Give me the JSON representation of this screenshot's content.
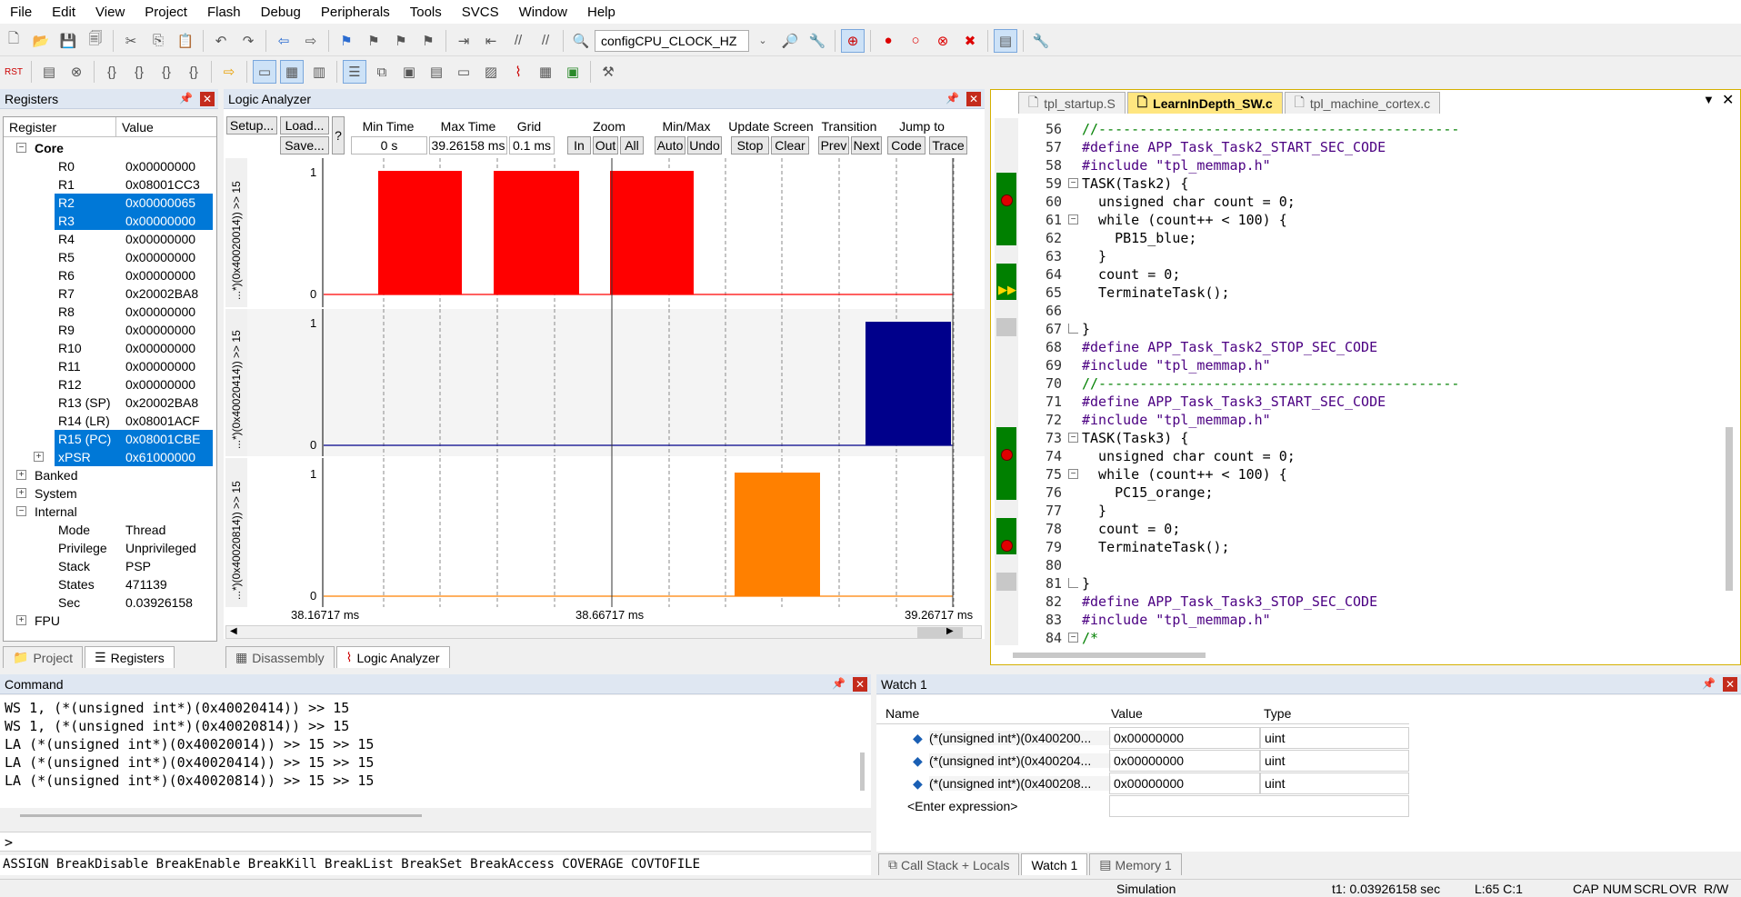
{
  "menu": [
    "File",
    "Edit",
    "View",
    "Project",
    "Flash",
    "Debug",
    "Peripherals",
    "Tools",
    "SVCS",
    "Window",
    "Help"
  ],
  "toolbar": {
    "target_combo": "configCPU_CLOCK_HZ"
  },
  "registers_panel": {
    "title": "Registers",
    "col_register": "Register",
    "col_value": "Value",
    "groups": {
      "core": "Core",
      "banked": "Banked",
      "system": "System",
      "internal": "Internal",
      "fpu": "FPU"
    },
    "core": [
      {
        "name": "R0",
        "value": "0x00000000"
      },
      {
        "name": "R1",
        "value": "0x08001CC3"
      },
      {
        "name": "R2",
        "value": "0x00000065"
      },
      {
        "name": "R3",
        "value": "0x00000000"
      },
      {
        "name": "R4",
        "value": "0x00000000"
      },
      {
        "name": "R5",
        "value": "0x00000000"
      },
      {
        "name": "R6",
        "value": "0x00000000"
      },
      {
        "name": "R7",
        "value": "0x20002BA8"
      },
      {
        "name": "R8",
        "value": "0x00000000"
      },
      {
        "name": "R9",
        "value": "0x00000000"
      },
      {
        "name": "R10",
        "value": "0x00000000"
      },
      {
        "name": "R11",
        "value": "0x00000000"
      },
      {
        "name": "R12",
        "value": "0x00000000"
      },
      {
        "name": "R13 (SP)",
        "value": "0x20002BA8"
      },
      {
        "name": "R14 (LR)",
        "value": "0x08001ACF"
      },
      {
        "name": "R15 (PC)",
        "value": "0x08001CBE"
      },
      {
        "name": "xPSR",
        "value": "0x61000000"
      }
    ],
    "internal": [
      {
        "name": "Mode",
        "value": "Thread"
      },
      {
        "name": "Privilege",
        "value": "Unprivileged"
      },
      {
        "name": "Stack",
        "value": "PSP"
      },
      {
        "name": "States",
        "value": "471139"
      },
      {
        "name": "Sec",
        "value": "0.03926158"
      }
    ],
    "tabs": [
      "Project",
      "Registers"
    ]
  },
  "logic_analyzer": {
    "title": "Logic Analyzer",
    "setup": "Setup...",
    "load": "Load...",
    "save": "Save...",
    "help": "?",
    "min_time_label": "Min Time",
    "min_time": "0 s",
    "max_time_label": "Max Time",
    "max_time": "39.26158 ms",
    "grid_label": "Grid",
    "grid": "0.1 ms",
    "zoom_label": "Zoom",
    "zoom_in": "In",
    "zoom_out": "Out",
    "zoom_all": "All",
    "minmax_label": "Min/Max",
    "minmax_auto": "Auto",
    "minmax_undo": "Undo",
    "update_label": "Update Screen",
    "update_stop": "Stop",
    "update_clear": "Clear",
    "transition_label": "Transition",
    "transition_prev": "Prev",
    "transition_next": "Next",
    "jump_label": "Jump to",
    "jump_code": "Code",
    "jump_trace": "Trace",
    "signals": [
      {
        "label": "...*)(0x40020014)) >> 15",
        "hi": "1",
        "lo": "0",
        "color": "#ff0000"
      },
      {
        "label": "...*)(0x40020414)) >> 15",
        "hi": "1",
        "lo": "0",
        "color": "#00008b"
      },
      {
        "label": "...*)(0x40020814)) >> 15",
        "hi": "1",
        "lo": "0",
        "color": "#ff8000"
      }
    ],
    "time_labels": [
      "38.16717 ms",
      "38.66717 ms",
      "39.26717 ms"
    ],
    "tabs": [
      "Disassembly",
      "Logic Analyzer"
    ]
  },
  "editor": {
    "tabs": [
      "tpl_startup.S",
      "LearnInDepth_SW.c",
      "tpl_machine_cortex.c"
    ],
    "lines": [
      {
        "n": "56",
        "text": "//--------------------------------------------",
        "kind": "comment"
      },
      {
        "n": "57",
        "text": "#define APP_Task_Task2_START_SEC_CODE",
        "kind": "define"
      },
      {
        "n": "58",
        "text": "#include \"tpl_memmap.h\"",
        "kind": "include"
      },
      {
        "n": "59",
        "text": "TASK(Task2) {",
        "kind": "plain"
      },
      {
        "n": "60",
        "text": "  unsigned char count = 0;",
        "kind": "decl"
      },
      {
        "n": "61",
        "text": "  while (count++ < 100) {",
        "kind": "while"
      },
      {
        "n": "62",
        "text": "    PB15_blue;",
        "kind": "plain"
      },
      {
        "n": "63",
        "text": "  }",
        "kind": "plain"
      },
      {
        "n": "64",
        "text": "  count = 0;",
        "kind": "assign"
      },
      {
        "n": "65",
        "text": "  TerminateTask();",
        "kind": "plain"
      },
      {
        "n": "66",
        "text": "",
        "kind": "plain"
      },
      {
        "n": "67",
        "text": "}",
        "kind": "plain"
      },
      {
        "n": "68",
        "text": "#define APP_Task_Task2_STOP_SEC_CODE",
        "kind": "define"
      },
      {
        "n": "69",
        "text": "#include \"tpl_memmap.h\"",
        "kind": "include"
      },
      {
        "n": "70",
        "text": "//--------------------------------------------",
        "kind": "comment"
      },
      {
        "n": "71",
        "text": "#define APP_Task_Task3_START_SEC_CODE",
        "kind": "define"
      },
      {
        "n": "72",
        "text": "#include \"tpl_memmap.h\"",
        "kind": "include"
      },
      {
        "n": "73",
        "text": "TASK(Task3) {",
        "kind": "plain"
      },
      {
        "n": "74",
        "text": "  unsigned char count = 0;",
        "kind": "decl"
      },
      {
        "n": "75",
        "text": "  while (count++ < 100) {",
        "kind": "while"
      },
      {
        "n": "76",
        "text": "    PC15_orange;",
        "kind": "plain"
      },
      {
        "n": "77",
        "text": "  }",
        "kind": "plain"
      },
      {
        "n": "78",
        "text": "  count = 0;",
        "kind": "assign"
      },
      {
        "n": "79",
        "text": "  TerminateTask();",
        "kind": "plain"
      },
      {
        "n": "80",
        "text": "",
        "kind": "plain"
      },
      {
        "n": "81",
        "text": "}",
        "kind": "plain"
      },
      {
        "n": "82",
        "text": "#define APP_Task_Task3_STOP_SEC_CODE",
        "kind": "define"
      },
      {
        "n": "83",
        "text": "#include \"tpl_memmap.h\"",
        "kind": "include"
      },
      {
        "n": "84",
        "text": "/*",
        "kind": "comment"
      }
    ]
  },
  "command": {
    "title": "Command",
    "lines": [
      "WS 1, (*(unsigned int*)(0x40020414)) >> 15",
      "WS 1, (*(unsigned int*)(0x40020814)) >> 15",
      "LA (*(unsigned int*)(0x40020014)) >> 15 >> 15",
      "LA (*(unsigned int*)(0x40020414)) >> 15 >> 15",
      "LA (*(unsigned int*)(0x40020814)) >> 15 >> 15"
    ],
    "prompt": ">",
    "keywords": "ASSIGN BreakDisable BreakEnable BreakKill BreakList BreakSet BreakAccess COVERAGE COVTOFILE"
  },
  "watch": {
    "title": "Watch 1",
    "col_name": "Name",
    "col_value": "Value",
    "col_type": "Type",
    "rows": [
      {
        "name": "(*(unsigned int*)(0x400200...",
        "value": "0x00000000",
        "type": "uint"
      },
      {
        "name": "(*(unsigned int*)(0x400204...",
        "value": "0x00000000",
        "type": "uint"
      },
      {
        "name": "(*(unsigned int*)(0x400208...",
        "value": "0x00000000",
        "type": "uint"
      }
    ],
    "enter": "<Enter expression>",
    "tabs": [
      "Call Stack + Locals",
      "Watch 1",
      "Memory 1"
    ]
  },
  "status": {
    "mode": "Simulation",
    "time": "t1: 0.03926158 sec",
    "pos": "L:65 C:1",
    "caps": "CAP",
    "num": "NUM",
    "scrl": "SCRL",
    "ovr": "OVR",
    "rw": "R/W"
  }
}
